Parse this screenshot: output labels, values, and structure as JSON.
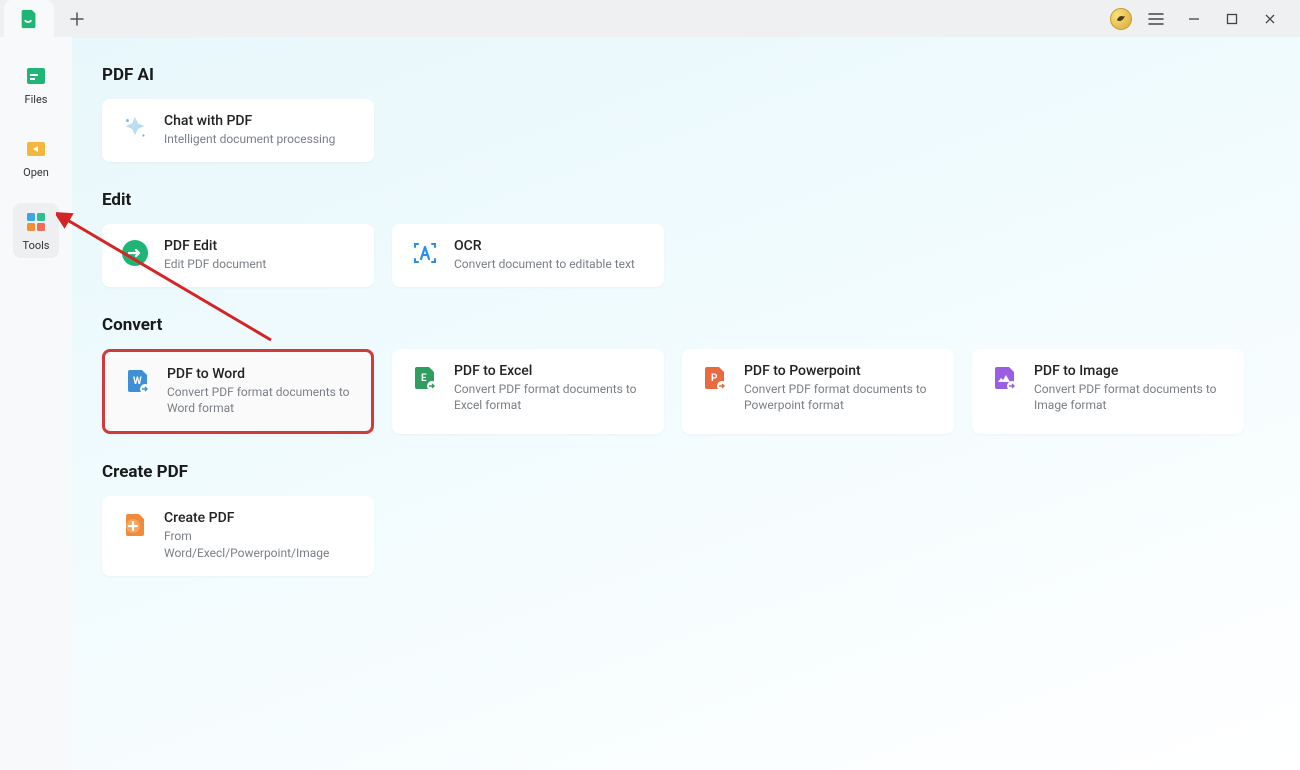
{
  "sidebar": {
    "items": [
      {
        "label": "Files"
      },
      {
        "label": "Open"
      },
      {
        "label": "Tools"
      }
    ]
  },
  "sections": {
    "pdfai": {
      "title": "PDF AI",
      "chat": {
        "title": "Chat with PDF",
        "desc": "Intelligent document processing"
      }
    },
    "edit": {
      "title": "Edit",
      "pdfedit": {
        "title": "PDF Edit",
        "desc": "Edit PDF document"
      },
      "ocr": {
        "title": "OCR",
        "desc": "Convert document to editable text"
      }
    },
    "convert": {
      "title": "Convert",
      "word": {
        "title": "PDF to Word",
        "desc": "Convert PDF format documents to Word format"
      },
      "excel": {
        "title": "PDF to Excel",
        "desc": "Convert PDF format documents to Excel format"
      },
      "ppt": {
        "title": "PDF to Powerpoint",
        "desc": "Convert PDF format documents to Powerpoint format"
      },
      "image": {
        "title": "PDF to Image",
        "desc": "Convert PDF format documents to Image format"
      }
    },
    "create": {
      "title": "Create PDF",
      "create": {
        "title": "Create PDF",
        "desc": "From Word/Execl/Powerpoint/Image"
      }
    }
  }
}
